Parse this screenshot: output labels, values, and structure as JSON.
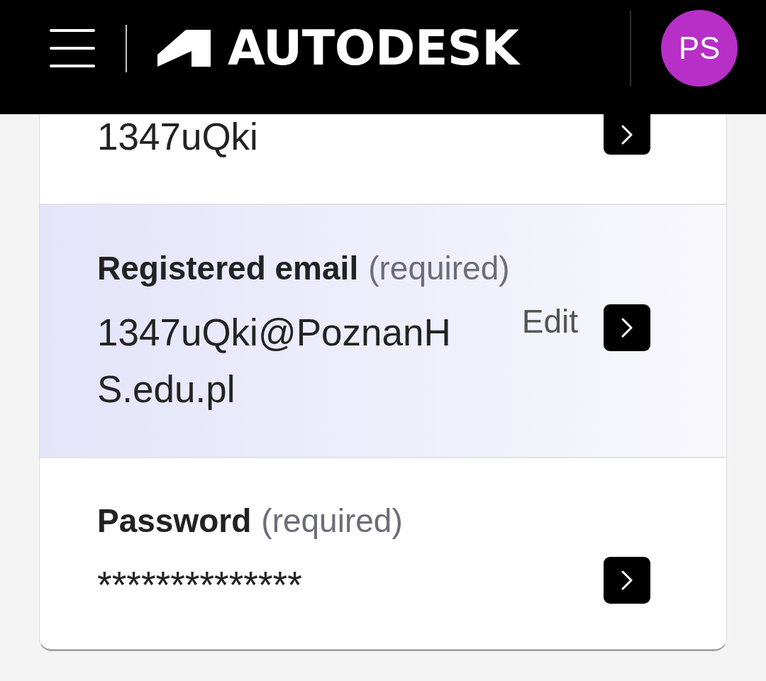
{
  "header": {
    "logo": "AUTODESK",
    "avatar": "PS"
  },
  "rows": [
    {
      "value": "1347uQki",
      "selected": false
    },
    {
      "label": "Registered email",
      "note": "(required)",
      "value": "1347uQki@PoznanHS.edu.pl",
      "action": "Edit",
      "selected": true
    },
    {
      "label": "Password",
      "note": "(required)",
      "value": "**************",
      "selected": false
    }
  ]
}
